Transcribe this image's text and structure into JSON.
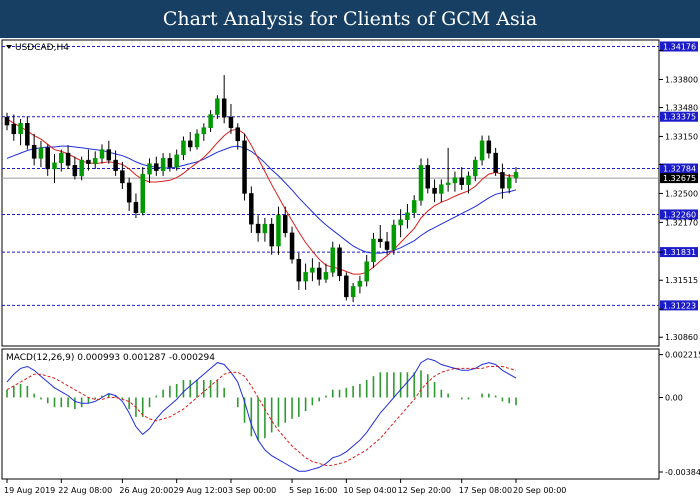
{
  "banner": {
    "title": "Chart Analysis for Clients of GCM Asia"
  },
  "colors": {
    "bull": "#009900",
    "bear": "#000000",
    "wick": "#000000",
    "ma_fast": "#d81e1e",
    "ma_slow": "#1f2fd6",
    "level": "#1b1bc8",
    "macd_line": "#1f2fd6",
    "signal_line": "#d81e1e",
    "histogram": "#2f9a2f",
    "label_bg": "#1b1bc8",
    "price_bg": "#000000"
  },
  "chart_data": [
    {
      "type": "candlestick",
      "title": "USDCAD,H4",
      "ylim": [
        1.3076,
        1.3425
      ],
      "y_ticks": [
        1.3086,
        1.3118,
        1.3151,
        1.3183,
        1.3217,
        1.325,
        1.3283,
        1.3315,
        1.3348,
        1.338,
        1.3413
      ],
      "y_tick_labels": [
        "1.30860",
        "",
        "1.31515",
        "",
        "1.32170",
        "1.32500",
        "",
        "1.33150",
        "1.33480",
        "1.33800",
        ""
      ],
      "x_labels": [
        "19 Aug 2019",
        "22 Aug 08:00",
        "26 Aug 20:00",
        "29 Aug 12:00",
        "3 Sep 00:00",
        "5 Sep 16:00",
        "10 Sep 04:00",
        "12 Sep 20:00",
        "17 Sep 08:00",
        "20 Sep 00:00"
      ],
      "levels": [
        {
          "value": 1.34176,
          "label": "1.34176"
        },
        {
          "value": 1.33375,
          "label": "1.33375"
        },
        {
          "value": 1.32784,
          "label": "1.32784"
        },
        {
          "value": 1.3226,
          "label": "1.32260"
        },
        {
          "value": 1.31831,
          "label": "1.31831"
        },
        {
          "value": 1.31223,
          "label": "1.31223"
        }
      ],
      "current_price": {
        "value": 1.32675,
        "label": "1.32675"
      },
      "candles": [
        [
          1.3337,
          1.3342,
          1.3322,
          1.3328
        ],
        [
          1.3329,
          1.334,
          1.331,
          1.3318
        ],
        [
          1.3318,
          1.3335,
          1.3305,
          1.333
        ],
        [
          1.333,
          1.3338,
          1.33,
          1.3305
        ],
        [
          1.3305,
          1.3318,
          1.3282,
          1.329
        ],
        [
          1.329,
          1.331,
          1.328,
          1.3302
        ],
        [
          1.3302,
          1.3306,
          1.327,
          1.3278
        ],
        [
          1.3278,
          1.3295,
          1.3262,
          1.3285
        ],
        [
          1.3285,
          1.33,
          1.3275,
          1.3296
        ],
        [
          1.3296,
          1.3305,
          1.3278,
          1.3282
        ],
        [
          1.3282,
          1.3292,
          1.3266,
          1.327
        ],
        [
          1.327,
          1.3292,
          1.3265,
          1.3288
        ],
        [
          1.3288,
          1.33,
          1.3276,
          1.3284
        ],
        [
          1.3284,
          1.3298,
          1.3278,
          1.329
        ],
        [
          1.329,
          1.3306,
          1.3284,
          1.33
        ],
        [
          1.33,
          1.331,
          1.3284,
          1.3288
        ],
        [
          1.3288,
          1.3299,
          1.327,
          1.3276
        ],
        [
          1.3276,
          1.3286,
          1.3255,
          1.3262
        ],
        [
          1.3262,
          1.3268,
          1.323,
          1.324
        ],
        [
          1.324,
          1.325,
          1.3222,
          1.3228
        ],
        [
          1.3228,
          1.328,
          1.3225,
          1.3272
        ],
        [
          1.3272,
          1.329,
          1.3262,
          1.3284
        ],
        [
          1.3284,
          1.3292,
          1.327,
          1.3276
        ],
        [
          1.3276,
          1.3296,
          1.327,
          1.329
        ],
        [
          1.329,
          1.3296,
          1.3275,
          1.328
        ],
        [
          1.328,
          1.33,
          1.3276,
          1.3294
        ],
        [
          1.3294,
          1.3315,
          1.3288,
          1.331
        ],
        [
          1.331,
          1.332,
          1.3298,
          1.3303
        ],
        [
          1.3303,
          1.3323,
          1.33,
          1.3318
        ],
        [
          1.3318,
          1.333,
          1.331,
          1.3325
        ],
        [
          1.3325,
          1.3345,
          1.332,
          1.334
        ],
        [
          1.334,
          1.3362,
          1.3335,
          1.3358
        ],
        [
          1.3358,
          1.3385,
          1.333,
          1.3337
        ],
        [
          1.3337,
          1.3352,
          1.3318,
          1.3325
        ],
        [
          1.3325,
          1.333,
          1.33,
          1.331
        ],
        [
          1.331,
          1.3318,
          1.3242,
          1.325
        ],
        [
          1.325,
          1.3258,
          1.3205,
          1.3215
        ],
        [
          1.3215,
          1.3225,
          1.3195,
          1.3205
        ],
        [
          1.3205,
          1.3222,
          1.3195,
          1.3215
        ],
        [
          1.3215,
          1.3222,
          1.318,
          1.319
        ],
        [
          1.319,
          1.3235,
          1.318,
          1.3225
        ],
        [
          1.3225,
          1.3235,
          1.32,
          1.3205
        ],
        [
          1.3205,
          1.3212,
          1.317,
          1.3175
        ],
        [
          1.3175,
          1.3182,
          1.314,
          1.315
        ],
        [
          1.315,
          1.317,
          1.314,
          1.316
        ],
        [
          1.316,
          1.3176,
          1.315,
          1.3165
        ],
        [
          1.3165,
          1.3172,
          1.3145,
          1.3152
        ],
        [
          1.3152,
          1.317,
          1.3148,
          1.316
        ],
        [
          1.316,
          1.3195,
          1.3155,
          1.3188
        ],
        [
          1.3188,
          1.3192,
          1.315,
          1.3156
        ],
        [
          1.3156,
          1.316,
          1.3128,
          1.3132
        ],
        [
          1.3132,
          1.3148,
          1.3126,
          1.3144
        ],
        [
          1.3144,
          1.3156,
          1.3136,
          1.315
        ],
        [
          1.315,
          1.318,
          1.3144,
          1.3172
        ],
        [
          1.3172,
          1.3205,
          1.3165,
          1.3198
        ],
        [
          1.3198,
          1.3214,
          1.3188,
          1.3195
        ],
        [
          1.3195,
          1.3206,
          1.318,
          1.3186
        ],
        [
          1.3186,
          1.322,
          1.318,
          1.3214
        ],
        [
          1.3214,
          1.3232,
          1.32,
          1.322
        ],
        [
          1.322,
          1.3238,
          1.321,
          1.3228
        ],
        [
          1.3228,
          1.3248,
          1.3222,
          1.3242
        ],
        [
          1.3242,
          1.329,
          1.3236,
          1.3282
        ],
        [
          1.3282,
          1.329,
          1.325,
          1.3256
        ],
        [
          1.3256,
          1.3266,
          1.324,
          1.325
        ],
        [
          1.325,
          1.3266,
          1.324,
          1.326
        ],
        [
          1.326,
          1.3302,
          1.3252,
          1.3262
        ],
        [
          1.3262,
          1.3275,
          1.3252,
          1.3268
        ],
        [
          1.3268,
          1.328,
          1.3254,
          1.326
        ],
        [
          1.326,
          1.3275,
          1.325,
          1.327
        ],
        [
          1.327,
          1.3292,
          1.3264,
          1.3288
        ],
        [
          1.3288,
          1.3316,
          1.3282,
          1.331
        ],
        [
          1.331,
          1.3316,
          1.329,
          1.3296
        ],
        [
          1.3296,
          1.3302,
          1.327,
          1.3274
        ],
        [
          1.3274,
          1.3284,
          1.3244,
          1.3256
        ],
        [
          1.3256,
          1.3272,
          1.325,
          1.3268
        ],
        [
          1.3268,
          1.328,
          1.3262,
          1.3274
        ]
      ],
      "ma_fast": [
        1.3335,
        1.333,
        1.3326,
        1.3321,
        1.3316,
        1.3312,
        1.3306,
        1.33,
        1.3298,
        1.3295,
        1.3291,
        1.3287,
        1.3285,
        1.3284,
        1.3285,
        1.3286,
        1.3285,
        1.3283,
        1.3278,
        1.3271,
        1.3266,
        1.3263,
        1.3263,
        1.3264,
        1.3265,
        1.3268,
        1.3273,
        1.3279,
        1.3285,
        1.3291,
        1.3299,
        1.3308,
        1.3316,
        1.3322,
        1.3323,
        1.3318,
        1.3305,
        1.329,
        1.3275,
        1.326,
        1.3246,
        1.3232,
        1.3219,
        1.3206,
        1.3194,
        1.3184,
        1.3175,
        1.3168,
        1.3166,
        1.3164,
        1.3161,
        1.3158,
        1.3158,
        1.316,
        1.3166,
        1.3173,
        1.3179,
        1.3186,
        1.3194,
        1.3202,
        1.321,
        1.3222,
        1.323,
        1.3236,
        1.324,
        1.3243,
        1.3247,
        1.325,
        1.3253,
        1.3258,
        1.3266,
        1.3272,
        1.3274,
        1.3272,
        1.327,
        1.327
      ],
      "ma_slow": [
        1.329,
        1.3293,
        1.3296,
        1.3299,
        1.3301,
        1.3302,
        1.3303,
        1.3303,
        1.3304,
        1.3304,
        1.3303,
        1.3302,
        1.3301,
        1.33,
        1.3299,
        1.3297,
        1.3295,
        1.3293,
        1.329,
        1.3286,
        1.3283,
        1.3281,
        1.328,
        1.3279,
        1.3279,
        1.328,
        1.3282,
        1.3284,
        1.3286,
        1.3289,
        1.3293,
        1.3297,
        1.33,
        1.3303,
        1.3304,
        1.3302,
        1.3298,
        1.3292,
        1.3285,
        1.3277,
        1.327,
        1.3262,
        1.3254,
        1.3245,
        1.3237,
        1.3229,
        1.3221,
        1.3214,
        1.3208,
        1.3202,
        1.3196,
        1.319,
        1.3186,
        1.3183,
        1.3182,
        1.3182,
        1.3183,
        1.3185,
        1.3188,
        1.3192,
        1.3196,
        1.3202,
        1.3207,
        1.3211,
        1.3215,
        1.3219,
        1.3223,
        1.3227,
        1.3231,
        1.3235,
        1.324,
        1.3245,
        1.3249,
        1.3251,
        1.3252,
        1.3254
      ]
    },
    {
      "type": "histogram",
      "title": "MACD(12,26,9) 0.000993 0.001287 -0.000294",
      "ylim": [
        -0.0042,
        0.0025
      ],
      "y_ticks": [
        0.00221,
        0.0,
        -0.00384
      ],
      "y_tick_labels": [
        "0.002215",
        "0.00",
        "-0.003844"
      ],
      "macd": [
        0.0008,
        0.0012,
        0.0015,
        0.0016,
        0.0014,
        0.0011,
        0.0008,
        0.0005,
        0.0003,
        0.0001,
        -0.0002,
        -0.0003,
        -0.0003,
        -0.0002,
        0.0,
        0.0002,
        0.0001,
        -0.0002,
        -0.0008,
        -0.0015,
        -0.0019,
        -0.0016,
        -0.0011,
        -0.0007,
        -0.0004,
        -0.0001,
        0.0003,
        0.0006,
        0.0009,
        0.0012,
        0.0015,
        0.0018,
        0.0017,
        0.0013,
        0.0008,
        -0.0002,
        -0.0014,
        -0.0022,
        -0.0027,
        -0.003,
        -0.0032,
        -0.0034,
        -0.0036,
        -0.0038,
        -0.0038,
        -0.0037,
        -0.0036,
        -0.0034,
        -0.0031,
        -0.003,
        -0.0028,
        -0.0025,
        -0.0022,
        -0.0018,
        -0.0013,
        -0.0008,
        -0.0004,
        0.0,
        0.0004,
        0.0008,
        0.0012,
        0.0018,
        0.002,
        0.0019,
        0.0017,
        0.0016,
        0.0015,
        0.0014,
        0.0014,
        0.0015,
        0.0017,
        0.0018,
        0.0017,
        0.0014,
        0.0012,
        0.001
      ],
      "signal": [
        0.0004,
        0.0006,
        0.0008,
        0.001,
        0.0012,
        0.0012,
        0.0011,
        0.001,
        0.0008,
        0.0006,
        0.0004,
        0.0002,
        0.0,
        -0.0001,
        -0.0001,
        0.0,
        0.0,
        -0.0001,
        -0.0002,
        -0.0005,
        -0.0009,
        -0.0011,
        -0.0012,
        -0.0011,
        -0.001,
        -0.0008,
        -0.0006,
        -0.0003,
        0.0,
        0.0003,
        0.0006,
        0.0009,
        0.0012,
        0.0013,
        0.0013,
        0.0011,
        0.0006,
        0.0,
        -0.0006,
        -0.0012,
        -0.0017,
        -0.0021,
        -0.0025,
        -0.0028,
        -0.0031,
        -0.0033,
        -0.0034,
        -0.0035,
        -0.0035,
        -0.0034,
        -0.0033,
        -0.0031,
        -0.0029,
        -0.0027,
        -0.0024,
        -0.0021,
        -0.0017,
        -0.0013,
        -0.0009,
        -0.0005,
        -0.0001,
        0.0004,
        0.0008,
        0.0011,
        0.0013,
        0.0014,
        0.0015,
        0.0015,
        0.0015,
        0.0015,
        0.0015,
        0.0016,
        0.0016,
        0.0016,
        0.0015,
        0.0014
      ]
    }
  ]
}
